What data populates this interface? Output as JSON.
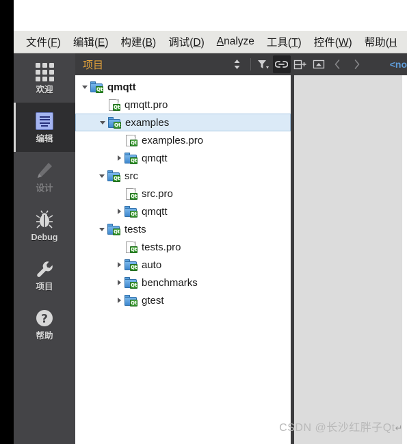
{
  "window": {
    "menubar": [
      {
        "name": "file",
        "text": "文件(",
        "mnemonic": "F",
        "tail": ")"
      },
      {
        "name": "edit",
        "text": "编辑(",
        "mnemonic": "E",
        "tail": ")"
      },
      {
        "name": "build",
        "text": "构建(",
        "mnemonic": "B",
        "tail": ")"
      },
      {
        "name": "debug",
        "text": "调试(",
        "mnemonic": "D",
        "tail": ")"
      },
      {
        "name": "analyze",
        "text": "",
        "mnemonic": "A",
        "tail": "nalyze"
      },
      {
        "name": "tools",
        "text": "工具(",
        "mnemonic": "T",
        "tail": ")"
      },
      {
        "name": "widgets",
        "text": "控件(",
        "mnemonic": "W",
        "tail": ")"
      },
      {
        "name": "help",
        "text": "帮助(",
        "mnemonic": "H",
        "tail": ""
      }
    ]
  },
  "modes": [
    {
      "label": "欢迎",
      "icon": "grid-icon",
      "active": false,
      "disabled": false
    },
    {
      "label": "编辑",
      "icon": "edit-icon",
      "active": true,
      "disabled": false
    },
    {
      "label": "设计",
      "icon": "pencil-icon",
      "active": false,
      "disabled": true
    },
    {
      "label": "Debug",
      "icon": "bug-icon",
      "active": false,
      "disabled": false
    },
    {
      "label": "项目",
      "icon": "wrench-icon",
      "active": false,
      "disabled": false
    },
    {
      "label": "帮助",
      "icon": "question-icon",
      "active": false,
      "disabled": false
    }
  ],
  "sidebar_header": {
    "title": "项目",
    "tools": [
      {
        "name": "sync-selection-icon",
        "active": false
      },
      {
        "name": "filter-icon",
        "active": false
      },
      {
        "name": "link-with-editor-icon",
        "active": true
      },
      {
        "name": "split-add-icon",
        "active": false
      },
      {
        "name": "minimize-icon",
        "active": false
      }
    ],
    "nav": [
      {
        "name": "back-icon",
        "glyph": "‹"
      },
      {
        "name": "forward-icon",
        "glyph": "›"
      }
    ],
    "document_label": "<no"
  },
  "tree": [
    {
      "name": "qmqtt",
      "label": "qmqtt",
      "type": "folder",
      "state": "open",
      "depth": 0,
      "bold": true,
      "selected": false
    },
    {
      "name": "qmqtt-pro",
      "label": "qmqtt.pro",
      "type": "file",
      "state": "leaf",
      "depth": 1,
      "bold": false,
      "selected": false
    },
    {
      "name": "examples",
      "label": "examples",
      "type": "folder",
      "state": "open",
      "depth": 1,
      "bold": false,
      "selected": true
    },
    {
      "name": "examples-pro",
      "label": "examples.pro",
      "type": "file",
      "state": "leaf",
      "depth": 2,
      "bold": false,
      "selected": false
    },
    {
      "name": "examples-qmqtt",
      "label": "qmqtt",
      "type": "folder",
      "state": "closed",
      "depth": 2,
      "bold": false,
      "selected": false
    },
    {
      "name": "src",
      "label": "src",
      "type": "folder",
      "state": "open",
      "depth": 1,
      "bold": false,
      "selected": false
    },
    {
      "name": "src-pro",
      "label": "src.pro",
      "type": "file",
      "state": "leaf",
      "depth": 2,
      "bold": false,
      "selected": false
    },
    {
      "name": "src-qmqtt",
      "label": "qmqtt",
      "type": "folder",
      "state": "closed",
      "depth": 2,
      "bold": false,
      "selected": false
    },
    {
      "name": "tests",
      "label": "tests",
      "type": "folder",
      "state": "open",
      "depth": 1,
      "bold": false,
      "selected": false
    },
    {
      "name": "tests-pro",
      "label": "tests.pro",
      "type": "file",
      "state": "leaf",
      "depth": 2,
      "bold": false,
      "selected": false
    },
    {
      "name": "auto",
      "label": "auto",
      "type": "folder",
      "state": "closed",
      "depth": 2,
      "bold": false,
      "selected": false
    },
    {
      "name": "benchmarks",
      "label": "benchmarks",
      "type": "folder",
      "state": "closed",
      "depth": 2,
      "bold": false,
      "selected": false
    },
    {
      "name": "gtest",
      "label": "gtest",
      "type": "folder",
      "state": "closed",
      "depth": 2,
      "bold": false,
      "selected": false
    }
  ],
  "icon_badge_text": "Qt",
  "watermark": {
    "text": "CSDN @长沙红胖子Qt",
    "return_glyph": "↵"
  },
  "colors": {
    "menubar_bg": "#e7e7e4",
    "sidebar_bg": "#444447",
    "sidebar_active_bg": "#2e2e30",
    "panel_header_bg": "#3c3c3e",
    "panel_title_fg": "#e4a33a",
    "tree_bg": "#ffffff",
    "selection_bg": "#dbeaf7",
    "selection_border": "#a8c8e4",
    "editor_bg": "#dcdcdc",
    "document_label_fg": "#5f9ddb",
    "watermark_fg": "#b9b9b9"
  }
}
